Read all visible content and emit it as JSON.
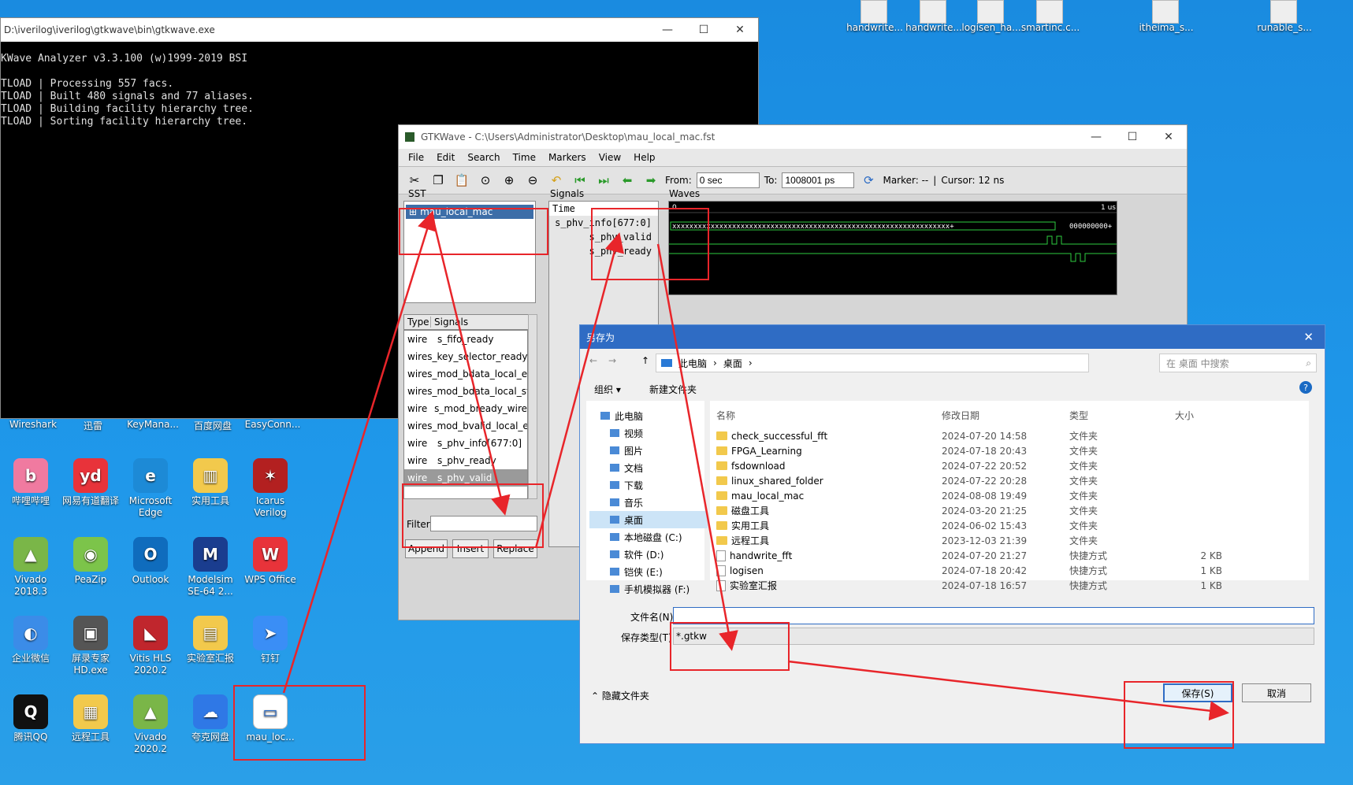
{
  "desktop_top": [
    {
      "label": "handwrite..."
    },
    {
      "label": "handwrite..."
    },
    {
      "label": "logisen_ha..."
    },
    {
      "label": "smartinc.c..."
    },
    {
      "label": "itheima_s..."
    },
    {
      "label": "runable_s..."
    }
  ],
  "desktop_row_labels": [
    "Wireshark",
    "迅雷",
    "KeyMana...",
    "百度网盘",
    "EasyConn..."
  ],
  "desktop_icons": [
    {
      "label": "哔哩哔哩",
      "color": "#f07aa0",
      "glyph": "b"
    },
    {
      "label": "网易有道翻译",
      "color": "#e8333a",
      "glyph": "yd"
    },
    {
      "label": "Microsoft Edge",
      "color": "#1d8ad6",
      "glyph": "e"
    },
    {
      "label": "实用工具",
      "color": "#f2c94c",
      "glyph": "▥"
    },
    {
      "label": "Icarus Verilog",
      "color": "#b32020",
      "glyph": "✶"
    },
    {
      "label": "Vivado 2018.3",
      "color": "#7ab648",
      "glyph": "▲"
    },
    {
      "label": "PeaZip",
      "color": "#7cc44a",
      "glyph": "◉"
    },
    {
      "label": "Outlook",
      "color": "#0f6cbd",
      "glyph": "O"
    },
    {
      "label": "Modelsim SE-64 2...",
      "color": "#1a3d8f",
      "glyph": "M"
    },
    {
      "label": "WPS Office",
      "color": "#e8333a",
      "glyph": "W"
    },
    {
      "label": "企业微信",
      "color": "#3b8ce8",
      "glyph": "◐"
    },
    {
      "label": "屏录专家 HD.exe",
      "color": "#555555",
      "glyph": "▣"
    },
    {
      "label": "Vitis HLS 2020.2",
      "color": "#c0262d",
      "glyph": "◣"
    },
    {
      "label": "实验室汇报",
      "color": "#f2c94c",
      "glyph": "▤"
    },
    {
      "label": "钉钉",
      "color": "#3a8ef6",
      "glyph": "➤"
    },
    {
      "label": "腾讯QQ",
      "color": "#111111",
      "glyph": "Q"
    },
    {
      "label": "远程工具",
      "color": "#f2c94c",
      "glyph": "▦"
    },
    {
      "label": "Vivado 2020.2",
      "color": "#7ab648",
      "glyph": "▲"
    },
    {
      "label": "夸克网盘",
      "color": "#2f78e6",
      "glyph": "☁"
    },
    {
      "label": "mau_loc...",
      "color": "#ffffff",
      "glyph": "▭"
    }
  ],
  "console": {
    "title": "D:\\iverilog\\iverilog\\gtkwave\\bin\\gtkwave.exe",
    "lines": [
      "KWave Analyzer v3.3.100 (w)1999-2019 BSI",
      "",
      "TLOAD | Processing 557 facs.",
      "TLOAD | Built 480 signals and 77 aliases.",
      "TLOAD | Building facility hierarchy tree.",
      "TLOAD | Sorting facility hierarchy tree."
    ]
  },
  "gtkwave": {
    "title": "GTKWave - C:\\Users\\Administrator\\Desktop\\mau_local_mac.fst",
    "menu": [
      "File",
      "Edit",
      "Search",
      "Time",
      "Markers",
      "View",
      "Help"
    ],
    "from_label": "From:",
    "from_value": "0 sec",
    "to_label": "To:",
    "to_value": "1008001 ps",
    "marker": "Marker: --",
    "cursor": "Cursor: 12 ns",
    "sst_label": "SST",
    "tree_item": "mau_local_mac",
    "type_header": "Type",
    "signals_header": "Signals",
    "signal_list": [
      {
        "type": "wire",
        "name": "s_fifo_ready"
      },
      {
        "type": "wire",
        "name": "s_key_selector_ready"
      },
      {
        "type": "wire",
        "name": "s_mod_bdata_local_er"
      },
      {
        "type": "wire",
        "name": "s_mod_bdata_local_st"
      },
      {
        "type": "wire",
        "name": "s_mod_bready_wire"
      },
      {
        "type": "wire",
        "name": "s_mod_bvalid_local_e"
      },
      {
        "type": "wire",
        "name": "s_phv_info[677:0]"
      },
      {
        "type": "wire",
        "name": "s_phv_ready"
      },
      {
        "type": "wire",
        "name": "s_phv_valid"
      }
    ],
    "filter_label": "Filter:",
    "append": "Append",
    "insert": "Insert",
    "replace": "Replace",
    "signals_panel": "Signals",
    "waves_panel": "Waves",
    "wave_names": [
      "Time",
      "s_phv_info[677:0]",
      "s_phv_valid",
      "s_phv_ready"
    ],
    "wave_value": "xxxxxxxxxxxxxxxxxxxxxxxxxxxxxxxxxxxxxxxxxxxxxxxxxxxxxxxxxxxxxxxxx+",
    "wave_tail": "000000000+",
    "time_start": "0",
    "time_end": "1 us"
  },
  "dialog": {
    "title": "另存为",
    "path": [
      "此电脑",
      "桌面"
    ],
    "search_placeholder": "在 桌面 中搜索",
    "organize": "组织 ▾",
    "new_folder": "新建文件夹",
    "nav": [
      "此电脑",
      "视频",
      "图片",
      "文档",
      "下载",
      "音乐",
      "桌面",
      "本地磁盘 (C:)",
      "软件 (D:)",
      "铠侠 (E:)",
      "手机模拟器 (F:)"
    ],
    "columns": [
      "名称",
      "修改日期",
      "类型",
      "大小"
    ],
    "files": [
      {
        "name": "check_successful_fft",
        "date": "2024-07-20 14:58",
        "type": "文件夹",
        "size": "",
        "kind": "folder"
      },
      {
        "name": "FPGA_Learning",
        "date": "2024-07-18 20:43",
        "type": "文件夹",
        "size": "",
        "kind": "folder"
      },
      {
        "name": "fsdownload",
        "date": "2024-07-22 20:52",
        "type": "文件夹",
        "size": "",
        "kind": "folder"
      },
      {
        "name": "linux_shared_folder",
        "date": "2024-07-22 20:28",
        "type": "文件夹",
        "size": "",
        "kind": "folder"
      },
      {
        "name": "mau_local_mac",
        "date": "2024-08-08 19:49",
        "type": "文件夹",
        "size": "",
        "kind": "folder"
      },
      {
        "name": "磁盘工具",
        "date": "2024-03-20 21:25",
        "type": "文件夹",
        "size": "",
        "kind": "folder"
      },
      {
        "name": "实用工具",
        "date": "2024-06-02 15:43",
        "type": "文件夹",
        "size": "",
        "kind": "folder"
      },
      {
        "name": "远程工具",
        "date": "2023-12-03 21:39",
        "type": "文件夹",
        "size": "",
        "kind": "folder"
      },
      {
        "name": "handwrite_fft",
        "date": "2024-07-20 21:27",
        "type": "快捷方式",
        "size": "2 KB",
        "kind": "shortcut"
      },
      {
        "name": "logisen",
        "date": "2024-07-18 20:42",
        "type": "快捷方式",
        "size": "1 KB",
        "kind": "shortcut"
      },
      {
        "name": "实验室汇报",
        "date": "2024-07-18 16:57",
        "type": "快捷方式",
        "size": "1 KB",
        "kind": "shortcut"
      }
    ],
    "filename_label": "文件名(N):",
    "filename_value": "",
    "filetype_label": "保存类型(T):",
    "filetype_value": "*.gtkw",
    "hide_folders": "隐藏文件夹",
    "save": "保存(S)",
    "cancel": "取消"
  }
}
